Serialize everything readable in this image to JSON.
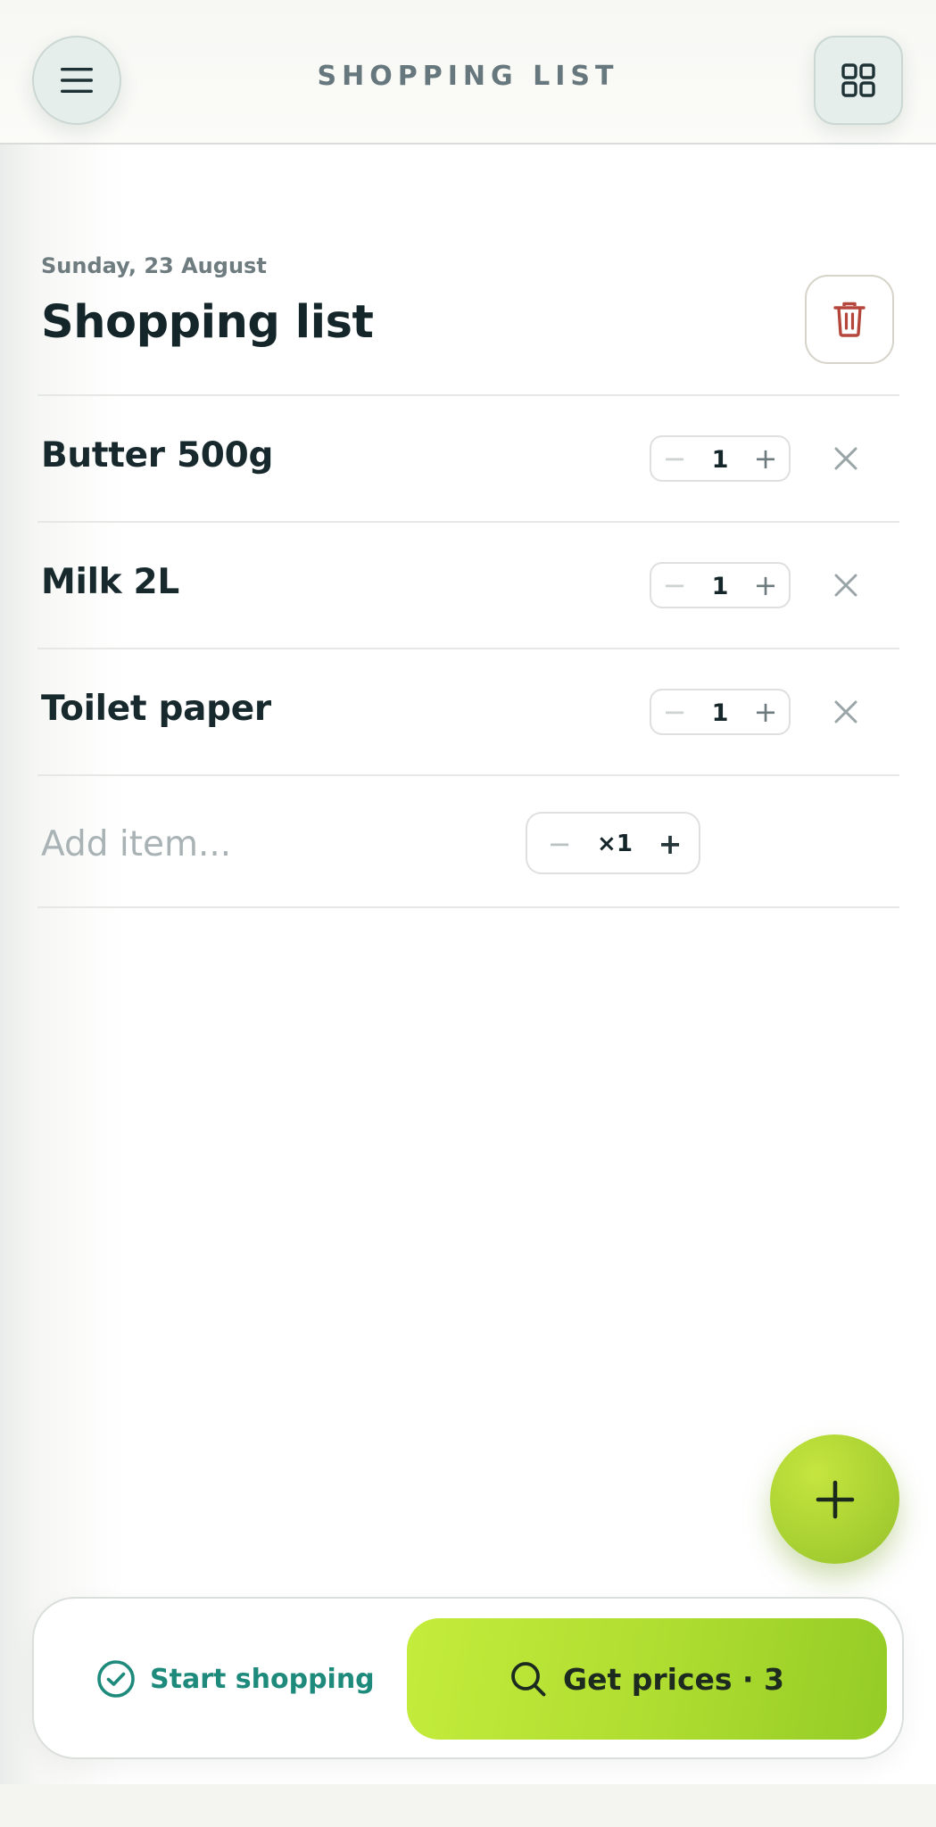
{
  "header": {
    "title": "SHOPPING LIST",
    "menu_icon": "hamburger-menu-icon",
    "grid_icon": "grid-icon"
  },
  "list": {
    "date": "Sunday, 23 August",
    "title": "Shopping list",
    "delete_icon": "trash-icon",
    "items": [
      {
        "name": "Butter 500g",
        "qty": "1"
      },
      {
        "name": "Milk 2L",
        "qty": "1"
      },
      {
        "name": "Toilet paper",
        "qty": "1"
      }
    ],
    "stepper": {
      "minus": "−",
      "plus": "+"
    },
    "remove_icon": "close-icon"
  },
  "add_item": {
    "placeholder": "Add item...",
    "qty": "×1",
    "minus": "−",
    "plus": "+"
  },
  "fab": {
    "icon": "plus-icon"
  },
  "bottom_bar": {
    "start_label": "Start shopping",
    "start_icon": "check-circle-icon",
    "prices_label": "Get prices · 3",
    "prices_icon": "search-icon"
  },
  "colors": {
    "accent_lime": "#b4e034",
    "accent_teal": "#1d8a7c",
    "danger": "#b5463c"
  }
}
